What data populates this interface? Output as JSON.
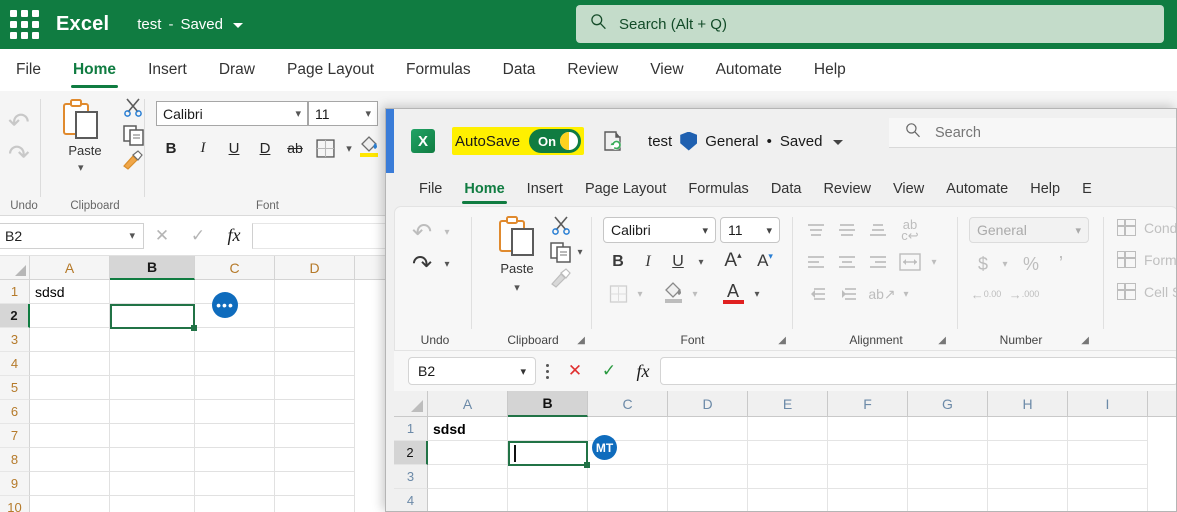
{
  "web_app": {
    "brand": "Excel",
    "doc_name": "test",
    "doc_sep": "-",
    "doc_status": "Saved",
    "waffle_icon": "app-launcher-icon",
    "search": {
      "placeholder": "Search (Alt + Q)",
      "icon": "search-icon"
    },
    "tabs": [
      {
        "label": "File",
        "active": false
      },
      {
        "label": "Home",
        "active": true
      },
      {
        "label": "Insert",
        "active": false
      },
      {
        "label": "Draw",
        "active": false
      },
      {
        "label": "Page Layout",
        "active": false
      },
      {
        "label": "Formulas",
        "active": false
      },
      {
        "label": "Data",
        "active": false
      },
      {
        "label": "Review",
        "active": false
      },
      {
        "label": "View",
        "active": false
      },
      {
        "label": "Automate",
        "active": false
      },
      {
        "label": "Help",
        "active": false
      }
    ],
    "ribbon": {
      "undo_group_label": "Undo",
      "undo_icon": "undo-arrow-icon",
      "redo_icon": "redo-arrow-icon",
      "clipboard_group_label": "Clipboard",
      "paste_label": "Paste",
      "paste_icon": "paste-clipboard-icon",
      "cut_icon": "scissors-icon",
      "copy_icon": "copy-icon",
      "format_painter_icon": "format-painter-icon",
      "font_group_label": "Font",
      "font_name": "Calibri",
      "font_size": "11",
      "bold": "B",
      "italic": "I",
      "underline": "U",
      "double_underline": "D",
      "strikethrough": "ab",
      "borders_icon": "borders-icon",
      "fill_color_icon": "fill-color-icon"
    },
    "formula_bar": {
      "name_box_value": "B2",
      "cancel_icon": "cancel-x-icon",
      "enter_icon": "enter-check-icon",
      "function_icon": "fx-icon",
      "input_value": ""
    },
    "grid": {
      "columns": [
        "A",
        "B",
        "C",
        "D"
      ],
      "rows": [
        "1",
        "2",
        "3",
        "4",
        "5",
        "6",
        "7",
        "8",
        "9",
        "10"
      ],
      "cells": [
        {
          "ref": "A1",
          "value": "sdsd"
        }
      ],
      "selected_cell": "B2",
      "selected_column": "B",
      "selected_row": "2",
      "presence_badge": "•••"
    }
  },
  "desktop_app": {
    "logo_icon": "excel-logo-icon",
    "logo_letter": "X",
    "autosave_label": "AutoSave",
    "autosave_state": "On",
    "autosave_highlight_color": "#fff000",
    "sync_icon": "sync-status-icon",
    "doc_name": "test",
    "shield_icon": "sensitivity-shield-icon",
    "sensitivity": "General",
    "doc_sep": "•",
    "doc_status": "Saved",
    "search": {
      "placeholder": "Search",
      "icon": "search-icon"
    },
    "tabs": [
      {
        "label": "File",
        "active": false
      },
      {
        "label": "Home",
        "active": true
      },
      {
        "label": "Insert",
        "active": false
      },
      {
        "label": "Page Layout",
        "active": false
      },
      {
        "label": "Formulas",
        "active": false
      },
      {
        "label": "Data",
        "active": false
      },
      {
        "label": "Review",
        "active": false
      },
      {
        "label": "View",
        "active": false
      },
      {
        "label": "Automate",
        "active": false
      },
      {
        "label": "Help",
        "active": false
      },
      {
        "label": "E",
        "active": false
      }
    ],
    "ribbon": {
      "undo_group_label": "Undo",
      "undo_icon": "undo-arrow-icon",
      "redo_icon": "redo-arrow-icon",
      "clipboard_group_label": "Clipboard",
      "paste_label": "Paste",
      "paste_icon": "paste-clipboard-icon",
      "cut_icon": "scissors-icon",
      "copy_icon": "copy-icon",
      "format_painter_icon": "format-painter-icon",
      "font_group_label": "Font",
      "font_name": "Calibri",
      "font_size": "11",
      "bold": "B",
      "italic": "I",
      "underline": "U",
      "grow_font": "A",
      "shrink_font": "A",
      "borders_icon": "borders-icon",
      "fill_color_icon": "fill-color-icon",
      "font_color_icon": "font-color-icon",
      "alignment_group_label": "Alignment",
      "align_top_icon": "align-top-icon",
      "align_middle_icon": "align-middle-icon",
      "align_bottom_icon": "align-bottom-icon",
      "wrap_text_icon": "wrap-text-icon",
      "align_left_icon": "align-left-icon",
      "align_center_icon": "align-center-icon",
      "align_right_icon": "align-right-icon",
      "merge_cells_icon": "merge-cells-icon",
      "decrease_indent_icon": "decrease-indent-icon",
      "increase_indent_icon": "increase-indent-icon",
      "orientation_icon": "text-orientation-icon",
      "number_group_label": "Number",
      "number_format": "General",
      "currency_icon": "currency-icon",
      "percent_icon": "percent-icon",
      "comma_icon": "comma-style-icon",
      "increase_decimal_icon": "increase-decimal-icon",
      "decrease_decimal_icon": "decrease-decimal-icon",
      "styles": [
        {
          "label": "Condit",
          "icon": "conditional-formatting-icon"
        },
        {
          "label": "Forma",
          "icon": "format-as-table-icon"
        },
        {
          "label": "Cell St",
          "icon": "cell-styles-icon"
        }
      ]
    },
    "formula_bar": {
      "name_box_value": "B2",
      "more_icon": "more-options-icon",
      "cancel_icon": "cancel-x-icon",
      "cancel_color": "#e03030",
      "enter_icon": "enter-check-icon",
      "enter_color": "#2a9a40",
      "function_icon": "fx-icon",
      "input_value": ""
    },
    "grid": {
      "columns": [
        "A",
        "B",
        "C",
        "D",
        "E",
        "F",
        "G",
        "H",
        "I"
      ],
      "rows": [
        "1",
        "2",
        "3",
        "4"
      ],
      "cells": [
        {
          "ref": "A1",
          "value": "sdsd"
        }
      ],
      "selected_cell": "B2",
      "selected_column": "B",
      "selected_row": "2",
      "presence_initials": "MT",
      "presence_color": "#0f6cbd"
    }
  }
}
